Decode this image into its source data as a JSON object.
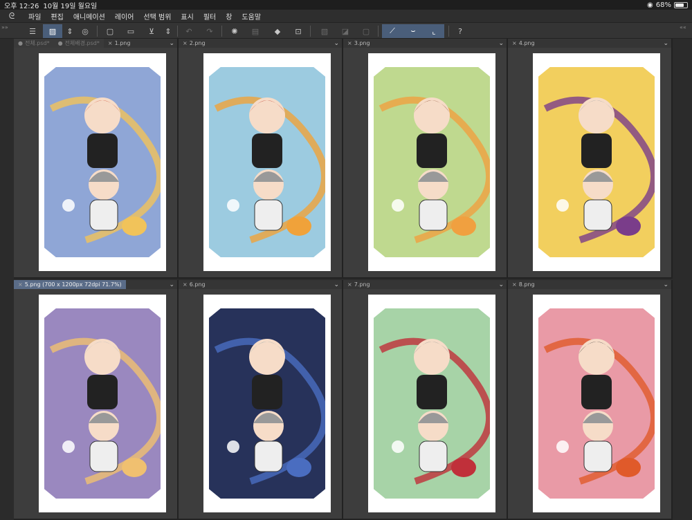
{
  "status": {
    "time": "오후 12:26",
    "date": "10월 19일 월요일",
    "battery": "68%",
    "battery_level": 0.68
  },
  "menu": {
    "items": [
      "파일",
      "편집",
      "애니메이션",
      "레이어",
      "선택 범위",
      "표시",
      "필터",
      "창",
      "도움말"
    ]
  },
  "icons": {
    "logo": "app-logo-icon",
    "menu": "hamburger-icon",
    "layer": "layer-icon",
    "stepper": "stepper-icon",
    "rotate": "rotate-icon",
    "newdoc": "new-document-icon",
    "open": "open-folder-icon",
    "save": "save-icon",
    "undo": "undo-icon",
    "redo": "redo-icon",
    "spinner": "loading-icon",
    "fill": "fill-bucket-icon",
    "transform": "transform-icon",
    "pen": "pen-icon",
    "brush": "brush-icon",
    "eraser": "eraser-icon",
    "help": "help-icon"
  },
  "panes": [
    {
      "tabs": [
        "전체.psd*",
        "전체배경.psd*",
        "1.png"
      ],
      "active": 2,
      "bg": "#8fa6d6"
    },
    {
      "tabs": [
        "2.png"
      ],
      "active": 0,
      "bg": "#9ccbe0"
    },
    {
      "tabs": [
        "3.png"
      ],
      "active": 0,
      "bg": "#bfd98f"
    },
    {
      "tabs": [
        "4.png"
      ],
      "active": 0,
      "bg": "#f2cf5e"
    },
    {
      "tabs": [
        "5.png (700 x 1200px 72dpi 71.7%)"
      ],
      "active": 0,
      "bg": "#9a88bf",
      "highlight": true
    },
    {
      "tabs": [
        "6.png"
      ],
      "active": 0,
      "bg": "#27325a"
    },
    {
      "tabs": [
        "7.png"
      ],
      "active": 0,
      "bg": "#a7d3a7"
    },
    {
      "tabs": [
        "8.png"
      ],
      "active": 0,
      "bg": "#e99aa6"
    }
  ]
}
